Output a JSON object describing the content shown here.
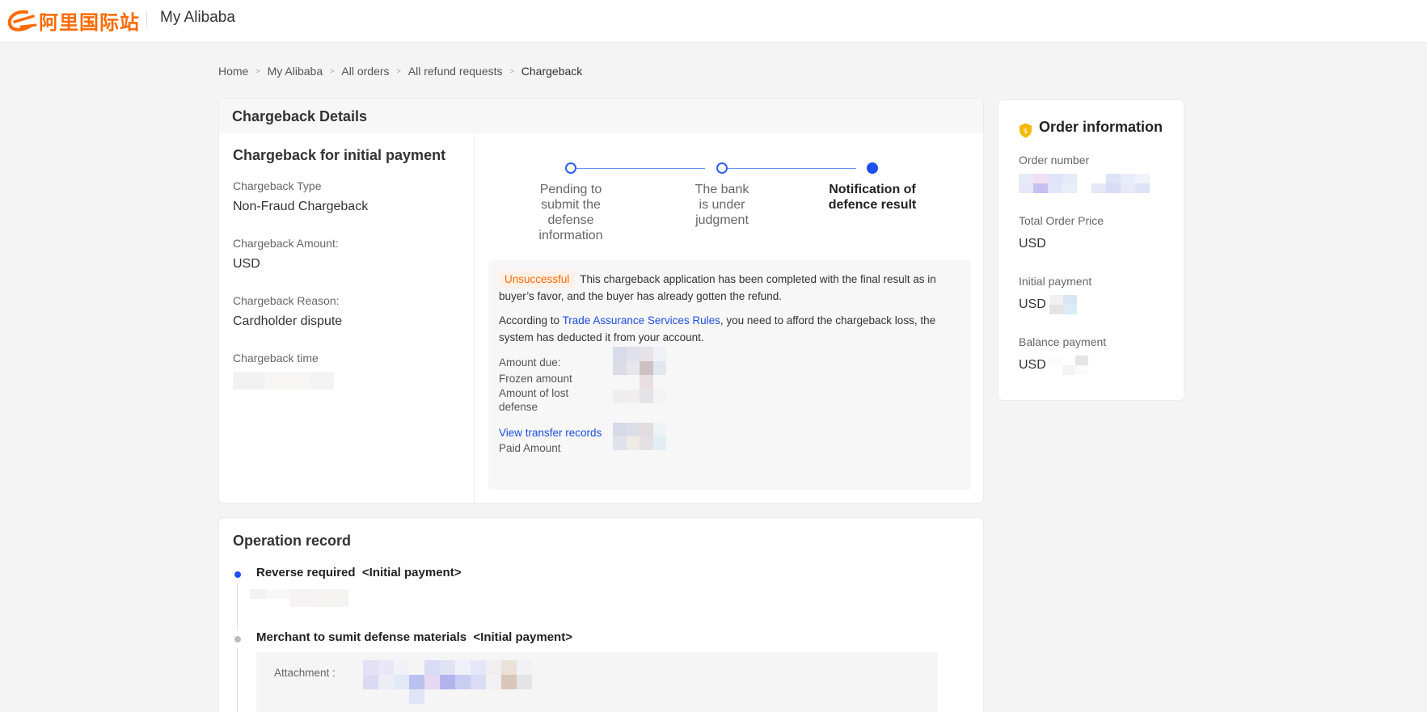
{
  "header": {
    "logo_text": "阿里国际站",
    "app_title": "My Alibaba"
  },
  "breadcrumb": {
    "items": [
      "Home",
      "My Alibaba",
      "All orders",
      "All refund requests",
      "Chargeback"
    ],
    "separator": ">"
  },
  "details": {
    "title": "Chargeback Details",
    "left_title": "Chargeback for initial payment",
    "type_label": "Chargeback Type",
    "type_value": "Non-Fraud Chargeback",
    "amount_label": "Chargeback Amount:",
    "amount_value": "USD",
    "reason_label": "Chargeback Reason:",
    "reason_value": "Cardholder dispute",
    "time_label": "Chargeback time"
  },
  "steps": [
    {
      "label": "Pending to submit the defense information",
      "state": "done"
    },
    {
      "label": "The bank is under judgment",
      "state": "done"
    },
    {
      "label": "Notification of defence result",
      "state": "current"
    }
  ],
  "result": {
    "badge": "Unsuccessful",
    "message": "This chargeback application has been completed with the final result as in buyer’s favor, and the buyer has already gotten the refund.",
    "rules_prefix": "According to ",
    "rules_link": "Trade Assurance Services Rules",
    "rules_suffix": ", you need to afford the chargeback loss, the system has deducted it from your account.",
    "amount_due_label": "Amount due:",
    "frozen_label": "Frozen amount",
    "lost_label": "Amount of lost defense",
    "transfer_link": "View transfer records",
    "paid_label": "Paid Amount"
  },
  "order": {
    "title": "Order information",
    "number_label": "Order number",
    "total_label": "Total Order Price",
    "total_currency": "USD",
    "initial_label": "Initial payment",
    "initial_currency": "USD",
    "balance_label": "Balance payment",
    "balance_currency": "USD"
  },
  "operation": {
    "title": "Operation record",
    "items": [
      {
        "title": "Reverse required",
        "tag": "<Initial payment>"
      },
      {
        "title": "Merchant to sumit defense materials",
        "tag": "<Initial payment>"
      }
    ],
    "attachment_label": "Attachment :"
  },
  "colors": {
    "brand": "#ff6a00",
    "accent": "#1f4ef5",
    "link": "#1b4fe0",
    "background": "#f4f4f4"
  }
}
